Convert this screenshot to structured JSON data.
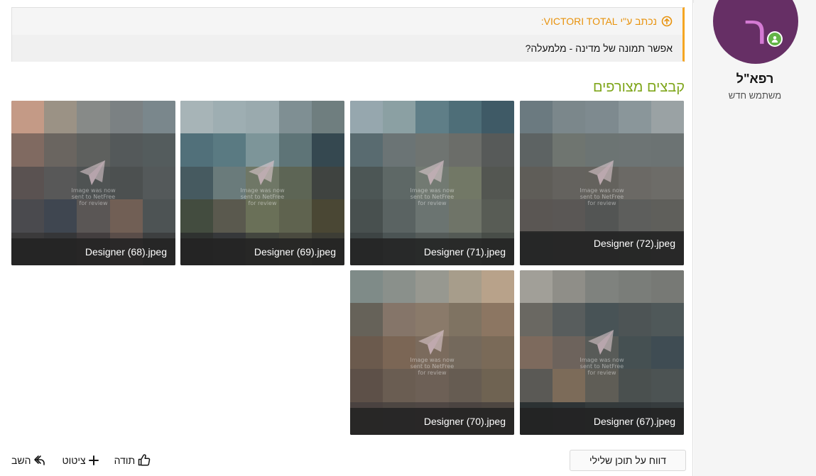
{
  "colors": {
    "quote_accent": "#f5a623",
    "attachments_title": "#7fa61b",
    "avatar_bg": "#662f65",
    "avatar_letter": "#d47ad3",
    "online": "#63b447"
  },
  "quote": {
    "author_label": "נכתב ע\"י VICTORI TOTAL:",
    "text": "אפשר תמונה של מדינה - מלמעלה?",
    "icon": "arrow-up-circle-icon"
  },
  "attachments": {
    "title": "קבצים מצורפים",
    "notice_lines": [
      "Image was now",
      "sent to NetFree",
      "for review"
    ],
    "files": [
      {
        "name": "Designer (72).jpeg"
      },
      {
        "name": "Designer (71).jpeg"
      },
      {
        "name": "Designer (69).jpeg"
      },
      {
        "name": "Designer (68).jpeg"
      },
      {
        "name": "Designer (67).jpeg"
      },
      {
        "name": "Designer (70).jpeg"
      }
    ]
  },
  "user": {
    "avatar_letter": "ר",
    "name": "רפא\"ל",
    "title": "משתמש חדש"
  },
  "actions": {
    "report_label": "דווח על תוכן שלילי",
    "like_label": "תודה",
    "quote_label": "ציטוט",
    "reply_label": "השב"
  }
}
